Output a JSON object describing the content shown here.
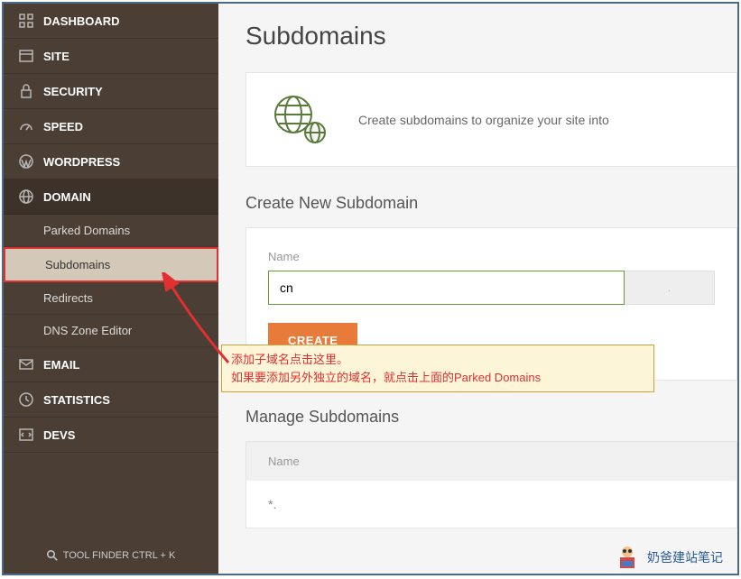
{
  "sidebar": {
    "items": [
      {
        "label": "DASHBOARD",
        "icon": "grid"
      },
      {
        "label": "SITE",
        "icon": "window"
      },
      {
        "label": "SECURITY",
        "icon": "lock"
      },
      {
        "label": "SPEED",
        "icon": "gauge"
      },
      {
        "label": "WORDPRESS",
        "icon": "wordpress"
      },
      {
        "label": "DOMAIN",
        "icon": "globe"
      },
      {
        "label": "EMAIL",
        "icon": "mail"
      },
      {
        "label": "STATISTICS",
        "icon": "clock"
      },
      {
        "label": "DEVS",
        "icon": "code"
      }
    ],
    "subs": [
      {
        "label": "Parked Domains"
      },
      {
        "label": "Subdomains"
      },
      {
        "label": "Redirects"
      },
      {
        "label": "DNS Zone Editor"
      }
    ],
    "tool_finder": "TOOL FINDER CTRL + K"
  },
  "main": {
    "title": "Subdomains",
    "info": "Create subdomains to organize your site into",
    "create_section": "Create New Subdomain",
    "name_label": "Name",
    "name_value": "cn",
    "suffix": ". ",
    "create_btn": "CREATE",
    "manage_section": "Manage Subdomains",
    "table_header": "Name",
    "table_row": "*."
  },
  "annotation": {
    "line1": "添加子域名点击这里。",
    "line2": "如果要添加另外独立的域名，就点击上面的Parked Domains"
  },
  "watermark": "奶爸建站笔记"
}
